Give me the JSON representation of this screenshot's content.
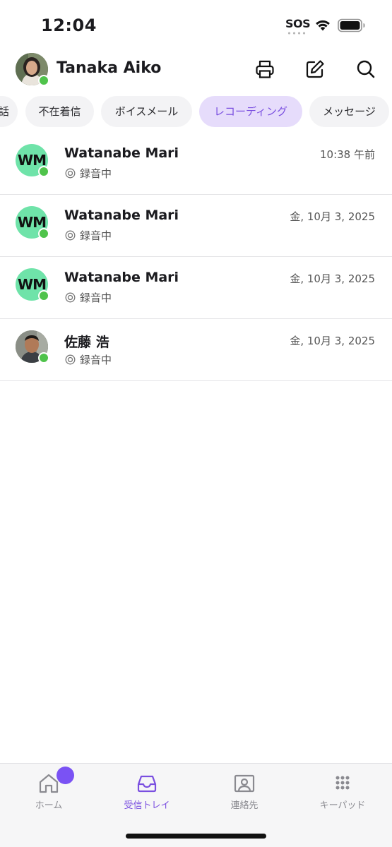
{
  "status_bar": {
    "time": "12:04",
    "sos": "SOS",
    "icons": [
      "wifi-icon",
      "battery-icon"
    ]
  },
  "header": {
    "user_name": "Tanaka Aiko",
    "actions": [
      "print-icon",
      "compose-icon",
      "search-icon"
    ]
  },
  "filters": [
    {
      "label": "話",
      "active": false
    },
    {
      "label": "不在着信",
      "active": false
    },
    {
      "label": "ボイスメール",
      "active": false
    },
    {
      "label": "レコーディング",
      "active": true
    },
    {
      "label": "メッセージ",
      "active": false
    }
  ],
  "recordings": [
    {
      "initials": "WM",
      "name": "Watanabe Mari",
      "status": "録音中",
      "date": "10:38 午前",
      "online": true
    },
    {
      "initials": "WM",
      "name": "Watanabe Mari",
      "status": "録音中",
      "date": "金, 10月 3, 2025",
      "online": true
    },
    {
      "initials": "WM",
      "name": "Watanabe Mari",
      "status": "録音中",
      "date": "金, 10月 3, 2025",
      "online": true
    },
    {
      "initials": "",
      "name": "佐藤 浩",
      "status": "録音中",
      "date": "金, 10月 3, 2025",
      "online": true
    }
  ],
  "tabbar": {
    "tabs": [
      {
        "label": "ホーム",
        "icon": "home-icon",
        "active": false
      },
      {
        "label": "受信トレイ",
        "icon": "inbox-icon",
        "active": true
      },
      {
        "label": "連絡先",
        "icon": "contacts-icon",
        "active": false
      },
      {
        "label": "キーパッド",
        "icon": "keypad-icon",
        "active": false
      }
    ]
  },
  "colors": {
    "accent": "#7a4fe0",
    "chip_active_bg": "#e6dcfb",
    "presence": "#4fc34b",
    "initials_bg": "#6fe3a9"
  }
}
